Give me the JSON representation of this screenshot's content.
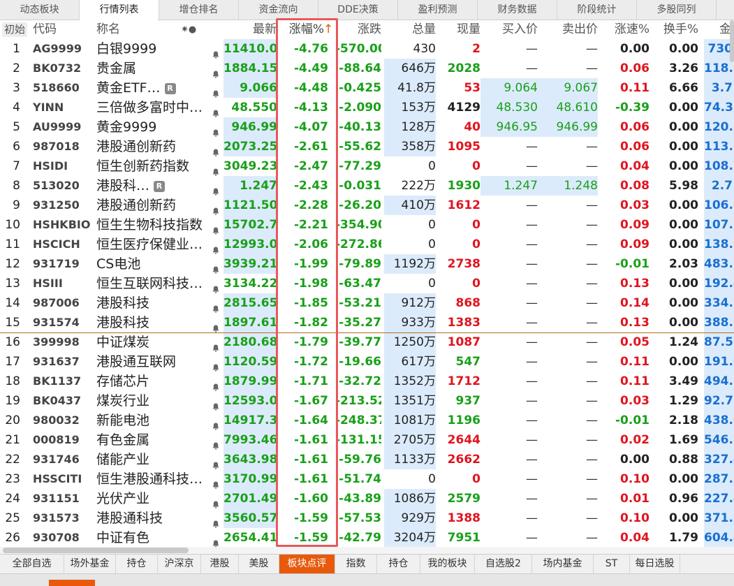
{
  "top_tabs": [
    "动态板块",
    "行情列表",
    "增仓排名",
    "资金流向",
    "DDE决策",
    "盈利预测",
    "财务数据",
    "阶段统计",
    "多股同列"
  ],
  "header": {
    "init": "初始",
    "code": "代码",
    "name": "称名",
    "icons": "✷●",
    "last": "最新",
    "pct": "涨幅%",
    "sort": "↑",
    "chg": "涨跌",
    "vol": "总量",
    "cur": "现量",
    "bid": "买入价",
    "ask": "卖出价",
    "speed": "涨速%",
    "turn": "换手%",
    "more": "金"
  },
  "colors": {
    "up": "#e0141e",
    "down": "#19a019",
    "highlight": "#dcebfb",
    "accent": "#e8590c",
    "box": "#e8585c"
  },
  "rows": [
    {
      "no": "1",
      "code": "AG9999",
      "name": "白银9999",
      "r": false,
      "last": "11410.00",
      "pct": "-4.76",
      "chg": "-570.00",
      "vol": "430",
      "cur": "2",
      "curc": "rd",
      "bid": "—",
      "ask": "—",
      "speed": "0.00",
      "speedc": "dk",
      "turn": "0.00",
      "more": "730"
    },
    {
      "no": "2",
      "code": "BK0732",
      "name": "贵金属",
      "r": false,
      "last": "1884.15",
      "pct": "-4.49",
      "chg": "-88.64",
      "vol": "646万",
      "cur": "2028",
      "curc": "g",
      "bid": "—",
      "ask": "—",
      "speed": "0.06",
      "speedc": "rd",
      "turn": "3.26",
      "more": "118.9"
    },
    {
      "no": "3",
      "code": "518660",
      "name": "黄金ETF…",
      "r": true,
      "last": "9.066",
      "pct": "-4.48",
      "chg": "-0.425",
      "vol": "41.8万",
      "cur": "53",
      "curc": "rd",
      "bid": "9.064",
      "ask": "9.067",
      "speed": "0.11",
      "speedc": "rd",
      "turn": "6.66",
      "more": "3.7"
    },
    {
      "no": "4",
      "code": "YINN",
      "name": "三倍做多富时中…",
      "r": false,
      "last": "48.550",
      "pct": "-4.13",
      "chg": "-2.090",
      "vol": "153万",
      "cur": "4129",
      "curc": "dk",
      "bid": "48.530",
      "ask": "48.610",
      "speed": "-0.39",
      "speedc": "g",
      "turn": "0.00",
      "more": "74.3"
    },
    {
      "no": "5",
      "code": "AU9999",
      "name": "黄金9999",
      "r": false,
      "last": "946.99",
      "pct": "-4.07",
      "chg": "-40.13",
      "vol": "128万",
      "cur": "40",
      "curc": "rd",
      "bid": "946.95",
      "ask": "946.99",
      "speed": "0.06",
      "speedc": "rd",
      "turn": "0.00",
      "more": "120.7"
    },
    {
      "no": "6",
      "code": "987018",
      "name": "港股通创新药",
      "r": false,
      "last": "2073.25",
      "pct": "-2.61",
      "chg": "-55.62",
      "vol": "358万",
      "cur": "1095",
      "curc": "rd",
      "bid": "—",
      "ask": "—",
      "speed": "0.06",
      "speedc": "rd",
      "turn": "0.00",
      "more": "113.6"
    },
    {
      "no": "7",
      "code": "HSIDI",
      "name": "恒生创新药指数",
      "r": false,
      "last": "3049.23",
      "pct": "-2.47",
      "chg": "-77.29",
      "vol": "0",
      "cur": "0",
      "curc": "rd",
      "bid": "—",
      "ask": "—",
      "speed": "0.04",
      "speedc": "rd",
      "turn": "0.00",
      "more": "108.2"
    },
    {
      "no": "8",
      "code": "513020",
      "name": "港股科…",
      "r": true,
      "last": "1.247",
      "pct": "-2.43",
      "chg": "-0.031",
      "vol": "222万",
      "cur": "1930",
      "curc": "g",
      "bid": "1.247",
      "ask": "1.248",
      "speed": "0.08",
      "speedc": "rd",
      "turn": "5.98",
      "more": "2.7"
    },
    {
      "no": "9",
      "code": "931250",
      "name": "港股通创新药",
      "r": false,
      "last": "1121.50",
      "pct": "-2.28",
      "chg": "-26.20",
      "vol": "410万",
      "cur": "1612",
      "curc": "rd",
      "bid": "—",
      "ask": "—",
      "speed": "0.03",
      "speedc": "rd",
      "turn": "0.00",
      "more": "106.7"
    },
    {
      "no": "10",
      "code": "HSHKBIO",
      "name": "恒生生物科技指数",
      "r": false,
      "last": "15702.76",
      "pct": "-2.21",
      "chg": "-354.90",
      "vol": "0",
      "cur": "0",
      "curc": "rd",
      "bid": "—",
      "ask": "—",
      "speed": "0.09",
      "speedc": "rd",
      "turn": "0.00",
      "more": "107.1"
    },
    {
      "no": "11",
      "code": "HSCICH",
      "name": "恒生医疗保健业…",
      "r": false,
      "last": "12993.00",
      "pct": "-2.06",
      "chg": "-272.86",
      "vol": "0",
      "cur": "0",
      "curc": "rd",
      "bid": "—",
      "ask": "—",
      "speed": "0.09",
      "speedc": "rd",
      "turn": "0.00",
      "more": "138.2"
    },
    {
      "no": "12",
      "code": "931719",
      "name": "CS电池",
      "r": false,
      "last": "3939.21",
      "pct": "-1.99",
      "chg": "-79.89",
      "vol": "1192万",
      "cur": "2738",
      "curc": "rd",
      "bid": "—",
      "ask": "—",
      "speed": "-0.01",
      "speedc": "g",
      "turn": "2.03",
      "more": "483.7"
    },
    {
      "no": "13",
      "code": "HSIII",
      "name": "恒生互联网科技…",
      "r": false,
      "last": "3134.22",
      "pct": "-1.98",
      "chg": "-63.47",
      "vol": "0",
      "cur": "0",
      "curc": "rd",
      "bid": "—",
      "ask": "—",
      "speed": "0.13",
      "speedc": "rd",
      "turn": "0.00",
      "more": "192.4"
    },
    {
      "no": "14",
      "code": "987006",
      "name": "港股科技",
      "r": false,
      "last": "2815.65",
      "pct": "-1.85",
      "chg": "-53.21",
      "vol": "912万",
      "cur": "868",
      "curc": "rd",
      "bid": "—",
      "ask": "—",
      "speed": "0.14",
      "speedc": "rd",
      "turn": "0.00",
      "more": "334.1"
    },
    {
      "no": "15",
      "code": "931574",
      "name": "港股科技",
      "r": false,
      "last": "1897.61",
      "pct": "-1.82",
      "chg": "-35.27",
      "vol": "933万",
      "cur": "1383",
      "curc": "rd",
      "bid": "—",
      "ask": "—",
      "speed": "0.13",
      "speedc": "rd",
      "turn": "0.00",
      "more": "388.6"
    },
    {
      "no": "16",
      "code": "399998",
      "name": "中证煤炭",
      "r": false,
      "last": "2180.68",
      "pct": "-1.79",
      "chg": "-39.77",
      "vol": "1250万",
      "cur": "1087",
      "curc": "rd",
      "bid": "—",
      "ask": "—",
      "speed": "0.05",
      "speedc": "rd",
      "turn": "1.24",
      "more": "87.5"
    },
    {
      "no": "17",
      "code": "931637",
      "name": "港股通互联网",
      "r": false,
      "last": "1120.59",
      "pct": "-1.72",
      "chg": "-19.66",
      "vol": "617万",
      "cur": "547",
      "curc": "g",
      "bid": "—",
      "ask": "—",
      "speed": "0.11",
      "speedc": "rd",
      "turn": "0.00",
      "more": "191.0"
    },
    {
      "no": "18",
      "code": "BK1137",
      "name": "存储芯片",
      "r": false,
      "last": "1879.99",
      "pct": "-1.71",
      "chg": "-32.72",
      "vol": "1352万",
      "cur": "1712",
      "curc": "rd",
      "bid": "—",
      "ask": "—",
      "speed": "0.11",
      "speedc": "rd",
      "turn": "3.49",
      "more": "494.1"
    },
    {
      "no": "19",
      "code": "BK0437",
      "name": "煤炭行业",
      "r": false,
      "last": "12593.07",
      "pct": "-1.67",
      "chg": "-213.52",
      "vol": "1351万",
      "cur": "937",
      "curc": "g",
      "bid": "—",
      "ask": "—",
      "speed": "0.03",
      "speedc": "rd",
      "turn": "1.29",
      "more": "92.7"
    },
    {
      "no": "20",
      "code": "980032",
      "name": "新能电池",
      "r": false,
      "last": "14917.35",
      "pct": "-1.64",
      "chg": "-248.37",
      "vol": "1081万",
      "cur": "1196",
      "curc": "g",
      "bid": "—",
      "ask": "—",
      "speed": "-0.01",
      "speedc": "g",
      "turn": "2.18",
      "more": "438.0"
    },
    {
      "no": "21",
      "code": "000819",
      "name": "有色金属",
      "r": false,
      "last": "7993.46",
      "pct": "-1.61",
      "chg": "-131.15",
      "vol": "2705万",
      "cur": "2644",
      "curc": "rd",
      "bid": "—",
      "ask": "—",
      "speed": "0.02",
      "speedc": "rd",
      "turn": "1.69",
      "more": "546.9"
    },
    {
      "no": "22",
      "code": "931746",
      "name": "储能产业",
      "r": false,
      "last": "3643.98",
      "pct": "-1.61",
      "chg": "-59.76",
      "vol": "1133万",
      "cur": "2662",
      "curc": "rd",
      "bid": "—",
      "ask": "—",
      "speed": "0.00",
      "speedc": "dk",
      "turn": "0.88",
      "more": "327.4"
    },
    {
      "no": "23",
      "code": "HSSCITI",
      "name": "恒生港股通科技…",
      "r": false,
      "last": "3170.99",
      "pct": "-1.61",
      "chg": "-51.74",
      "vol": "0",
      "cur": "0",
      "curc": "rd",
      "bid": "—",
      "ask": "—",
      "speed": "0.10",
      "speedc": "rd",
      "turn": "0.00",
      "more": "287.8"
    },
    {
      "no": "24",
      "code": "931151",
      "name": "光伏产业",
      "r": false,
      "last": "2701.49",
      "pct": "-1.60",
      "chg": "-43.89",
      "vol": "1086万",
      "cur": "2579",
      "curc": "g",
      "bid": "—",
      "ask": "—",
      "speed": "0.01",
      "speedc": "rd",
      "turn": "0.96",
      "more": "227.4"
    },
    {
      "no": "25",
      "code": "931573",
      "name": "港股通科技",
      "r": false,
      "last": "3560.57",
      "pct": "-1.59",
      "chg": "-57.53",
      "vol": "929万",
      "cur": "1388",
      "curc": "rd",
      "bid": "—",
      "ask": "—",
      "speed": "0.10",
      "speedc": "rd",
      "turn": "0.00",
      "more": "371.7"
    },
    {
      "no": "26",
      "code": "930708",
      "name": "中证有色",
      "r": false,
      "last": "2654.41",
      "pct": "-1.59",
      "chg": "-42.79",
      "vol": "3204万",
      "cur": "7951",
      "curc": "g",
      "bid": "—",
      "ask": "—",
      "speed": "0.04",
      "speedc": "rd",
      "turn": "1.79",
      "more": "604.4"
    }
  ],
  "bottom_tabs": [
    "全部自选",
    "场外基金",
    "持仓",
    "沪深京",
    "港股",
    "美股",
    "板块点评",
    "指数",
    "持仓",
    "我的板块",
    "自选股2",
    "场内基金",
    "ST",
    "每日选股"
  ]
}
